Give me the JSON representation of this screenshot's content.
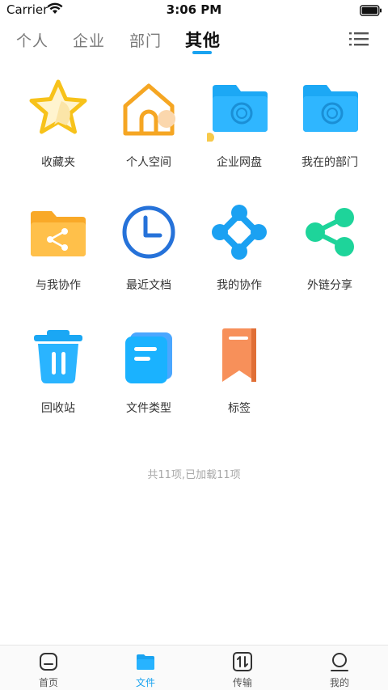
{
  "status_bar": {
    "carrier": "Carrier",
    "time": "3:06 PM"
  },
  "tabs": [
    {
      "label": "个人"
    },
    {
      "label": "企业"
    },
    {
      "label": "部门"
    },
    {
      "label": "其他",
      "active": true
    }
  ],
  "grid": {
    "items": [
      {
        "label": "收藏夹",
        "icon": "star-icon"
      },
      {
        "label": "个人空间",
        "icon": "house-icon"
      },
      {
        "label": "企业网盘",
        "icon": "enterprise-folder-icon"
      },
      {
        "label": "我在的部门",
        "icon": "department-folder-icon"
      },
      {
        "label": "与我协作",
        "icon": "shared-folder-icon"
      },
      {
        "label": "最近文档",
        "icon": "clock-icon"
      },
      {
        "label": "我的协作",
        "icon": "collaboration-icon"
      },
      {
        "label": "外链分享",
        "icon": "share-icon"
      },
      {
        "label": "回收站",
        "icon": "trash-icon"
      },
      {
        "label": "文件类型",
        "icon": "file-type-icon"
      },
      {
        "label": "标签",
        "icon": "tag-icon"
      }
    ]
  },
  "footer_text": "共11项,已加载11项",
  "bottom_nav": [
    {
      "label": "首页",
      "icon": "home-icon"
    },
    {
      "label": "文件",
      "icon": "files-icon",
      "active": true
    },
    {
      "label": "传输",
      "icon": "transfer-icon"
    },
    {
      "label": "我的",
      "icon": "profile-icon"
    }
  ],
  "colors": {
    "accent": "#1aa3f0",
    "star": "#f7c21a",
    "orange": "#f5a623",
    "green": "#1ed49a",
    "tag": "#f7905a"
  }
}
